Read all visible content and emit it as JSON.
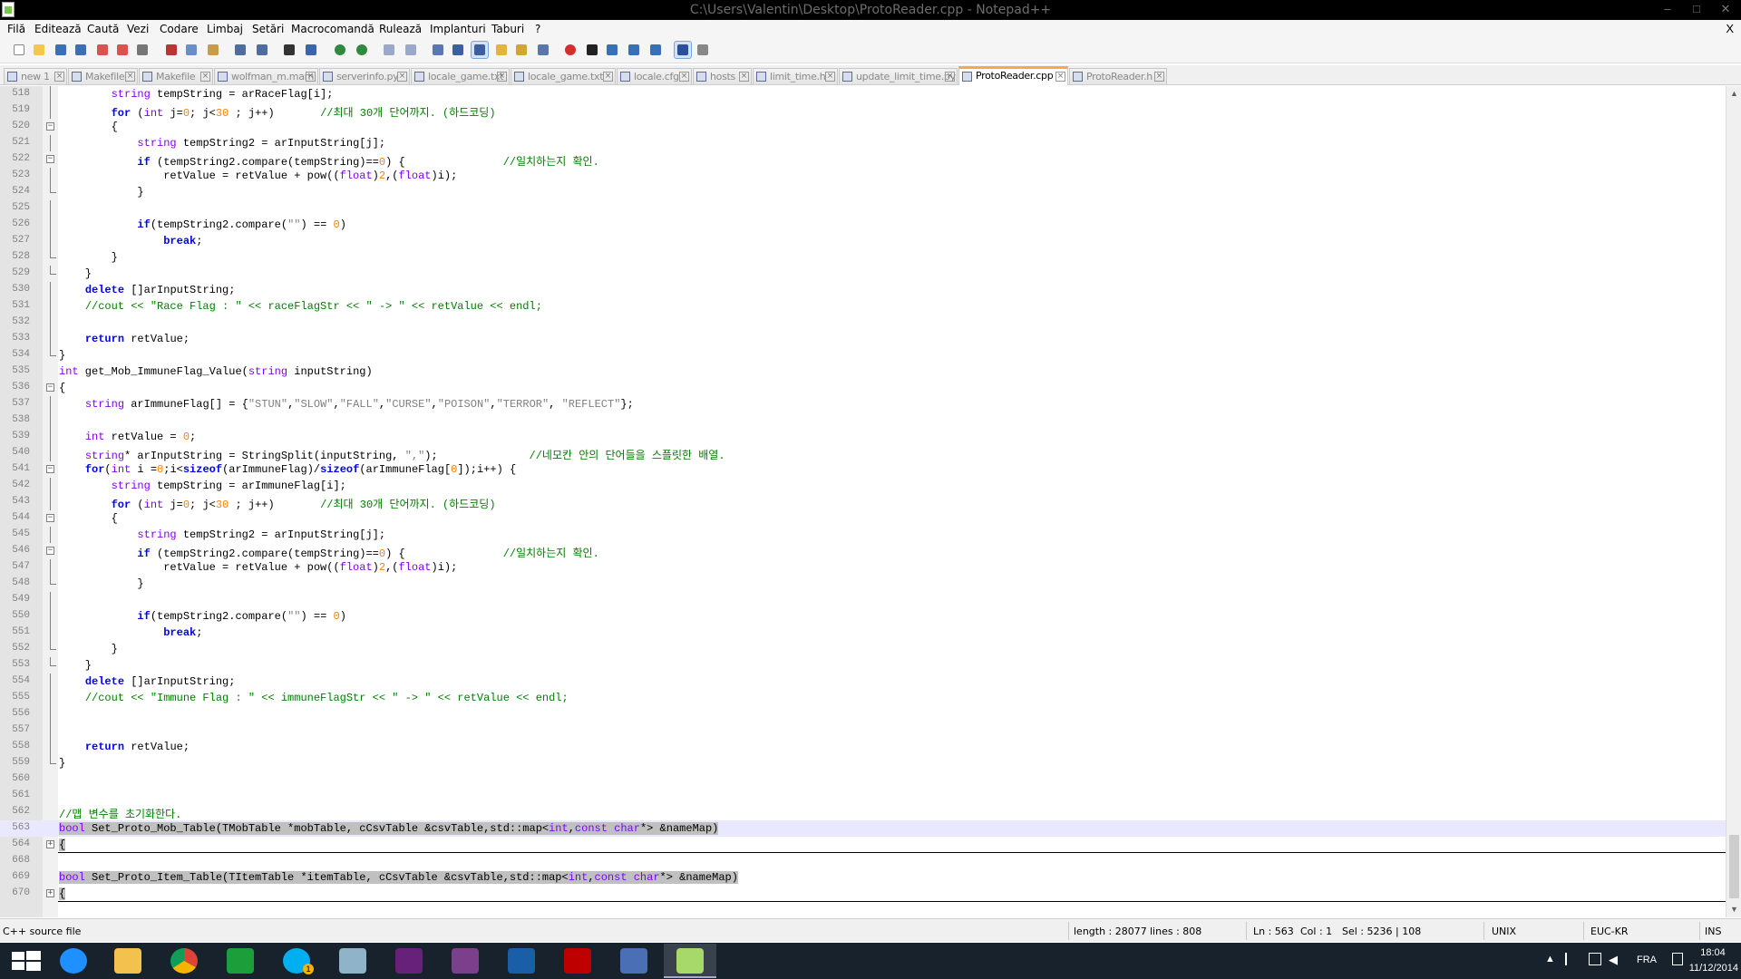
{
  "window": {
    "title": "C:\\Users\\Valentin\\Desktop\\ProtoReader.cpp - Notepad++",
    "minimize": "–",
    "maximize": "□",
    "close": "✕"
  },
  "menu": {
    "items": [
      "Filă",
      "Editează",
      "Caută",
      "Vezi",
      "Codare",
      "Limbaj",
      "Setări",
      "Macrocomandă",
      "Rulează",
      "Implanturi",
      "Taburi",
      "?"
    ],
    "close": "X"
  },
  "toolbar": {
    "icons": [
      "new-file-icon",
      "open-file-icon",
      "save-icon",
      "save-all-icon",
      "close-icon",
      "close-all-icon",
      "print-icon",
      "cut-icon",
      "copy-icon",
      "paste-icon",
      "undo-icon",
      "redo-icon",
      "find-icon",
      "replace-icon",
      "zoom-in-icon",
      "zoom-out-icon",
      "sync-vertical-icon",
      "sync-horizontal-icon",
      "word-wrap-icon",
      "show-all-chars-icon",
      "indent-guide-icon",
      "user-defined-lang-icon",
      "doc-map-icon",
      "function-list-icon",
      "record-macro-icon",
      "stop-record-icon",
      "play-macro-icon",
      "run-macro-multiple-icon",
      "save-macro-icon",
      "spellcheck-icon",
      "plugin-icon"
    ]
  },
  "tabs": [
    {
      "label": "new  1",
      "active": false
    },
    {
      "label": "Makefile",
      "active": false
    },
    {
      "label": "Makefile",
      "active": false
    },
    {
      "label": "wolfman_m.mam",
      "active": false
    },
    {
      "label": "serverinfo.py",
      "active": false
    },
    {
      "label": "locale_game.txt",
      "active": false
    },
    {
      "label": "locale_game.txt",
      "active": false
    },
    {
      "label": "locale.cfg",
      "active": false
    },
    {
      "label": "hosts",
      "active": false
    },
    {
      "label": "limit_time.h",
      "active": false
    },
    {
      "label": "update_limit_time.py",
      "active": false
    },
    {
      "label": "ProtoReader.cpp",
      "active": true
    },
    {
      "label": "ProtoReader.h",
      "active": false
    }
  ],
  "editor": {
    "lines": [
      {
        "n": "518",
        "code": "        string tempString = arRaceFlag[i];"
      },
      {
        "n": "519",
        "code": "        for (int j=0; j<30 ; j++)       //최대 30개 단어까지. (하드코딩)"
      },
      {
        "n": "520",
        "code": "        {"
      },
      {
        "n": "521",
        "code": "            string tempString2 = arInputString[j];"
      },
      {
        "n": "522",
        "code": "            if (tempString2.compare(tempString)==0) {               //일치하는지 확인."
      },
      {
        "n": "523",
        "code": "                retValue = retValue + pow((float)2,(float)i);"
      },
      {
        "n": "524",
        "code": "            }"
      },
      {
        "n": "525",
        "code": ""
      },
      {
        "n": "526",
        "code": "            if(tempString2.compare(\"\") == 0)"
      },
      {
        "n": "527",
        "code": "                break;"
      },
      {
        "n": "528",
        "code": "        }"
      },
      {
        "n": "529",
        "code": "    }"
      },
      {
        "n": "530",
        "code": "    delete []arInputString;"
      },
      {
        "n": "531",
        "code": "    //cout << \"Race Flag : \" << raceFlagStr << \" -> \" << retValue << endl;"
      },
      {
        "n": "532",
        "code": ""
      },
      {
        "n": "533",
        "code": "    return retValue;"
      },
      {
        "n": "534",
        "code": "}"
      },
      {
        "n": "535",
        "code": "int get_Mob_ImmuneFlag_Value(string inputString)"
      },
      {
        "n": "536",
        "code": "{"
      },
      {
        "n": "537",
        "code": "    string arImmuneFlag[] = {\"STUN\",\"SLOW\",\"FALL\",\"CURSE\",\"POISON\",\"TERROR\", \"REFLECT\"};"
      },
      {
        "n": "538",
        "code": ""
      },
      {
        "n": "539",
        "code": "    int retValue = 0;"
      },
      {
        "n": "540",
        "code": "    string* arInputString = StringSplit(inputString, \",\");              //네모칸 안의 단어들을 스플릿한 배열."
      },
      {
        "n": "541",
        "code": "    for(int i =0;i<sizeof(arImmuneFlag)/sizeof(arImmuneFlag[0]);i++) {"
      },
      {
        "n": "542",
        "code": "        string tempString = arImmuneFlag[i];"
      },
      {
        "n": "543",
        "code": "        for (int j=0; j<30 ; j++)       //최대 30개 단어까지. (하드코딩)"
      },
      {
        "n": "544",
        "code": "        {"
      },
      {
        "n": "545",
        "code": "            string tempString2 = arInputString[j];"
      },
      {
        "n": "546",
        "code": "            if (tempString2.compare(tempString)==0) {               //일치하는지 확인."
      },
      {
        "n": "547",
        "code": "                retValue = retValue + pow((float)2,(float)i);"
      },
      {
        "n": "548",
        "code": "            }"
      },
      {
        "n": "549",
        "code": ""
      },
      {
        "n": "550",
        "code": "            if(tempString2.compare(\"\") == 0)"
      },
      {
        "n": "551",
        "code": "                break;"
      },
      {
        "n": "552",
        "code": "        }"
      },
      {
        "n": "553",
        "code": "    }"
      },
      {
        "n": "554",
        "code": "    delete []arInputString;"
      },
      {
        "n": "555",
        "code": "    //cout << \"Immune Flag : \" << immuneFlagStr << \" -> \" << retValue << endl;"
      },
      {
        "n": "556",
        "code": ""
      },
      {
        "n": "557",
        "code": ""
      },
      {
        "n": "558",
        "code": "    return retValue;"
      },
      {
        "n": "559",
        "code": "}"
      },
      {
        "n": "560",
        "code": ""
      },
      {
        "n": "561",
        "code": ""
      },
      {
        "n": "562",
        "code": "//맵 변수를 초기화한다."
      },
      {
        "n": "563",
        "code": "bool Set_Proto_Mob_Table(TMobTable *mobTable, cCsvTable &csvTable,std::map<int,const char*> &nameMap)"
      },
      {
        "n": "564",
        "code": "{"
      },
      {
        "n": "668",
        "code": ""
      },
      {
        "n": "669",
        "code": "bool Set_Proto_Item_Table(TItemTable *itemTable, cCsvTable &csvTable,std::map<int,const char*> &nameMap)"
      },
      {
        "n": "670",
        "code": "{"
      }
    ]
  },
  "status": {
    "filetype": "C++ source file",
    "length": "length : 28077",
    "lines": "lines : 808",
    "ln": "Ln : 563",
    "col": "Col : 1",
    "sel": "Sel : 5236 | 108",
    "eol": "UNIX",
    "encoding": "EUC-KR",
    "mode": "INS"
  },
  "taskbar": {
    "apps": [
      "windows-start-icon",
      "internet-explorer-icon",
      "file-explorer-icon",
      "chrome-icon",
      "store-icon",
      "skype-icon",
      "notepad-icon",
      "visual-studio-icon",
      "winrar-icon",
      "virtualbox-icon",
      "filezilla-icon",
      "network-tool-icon",
      "notepad-plus-plus-icon"
    ],
    "skype_badge": "1",
    "language": "FRA",
    "time": "18:04",
    "date": "11/12/2014"
  },
  "colors": {
    "keyword": "#0000ff",
    "type": "#8000ff",
    "number": "#ff8000",
    "string": "#808080",
    "comment": "#008000",
    "active_tab_accent": "#f7a94a",
    "caret_line": "#e8e8ff",
    "selection": "#c0c0c0"
  }
}
